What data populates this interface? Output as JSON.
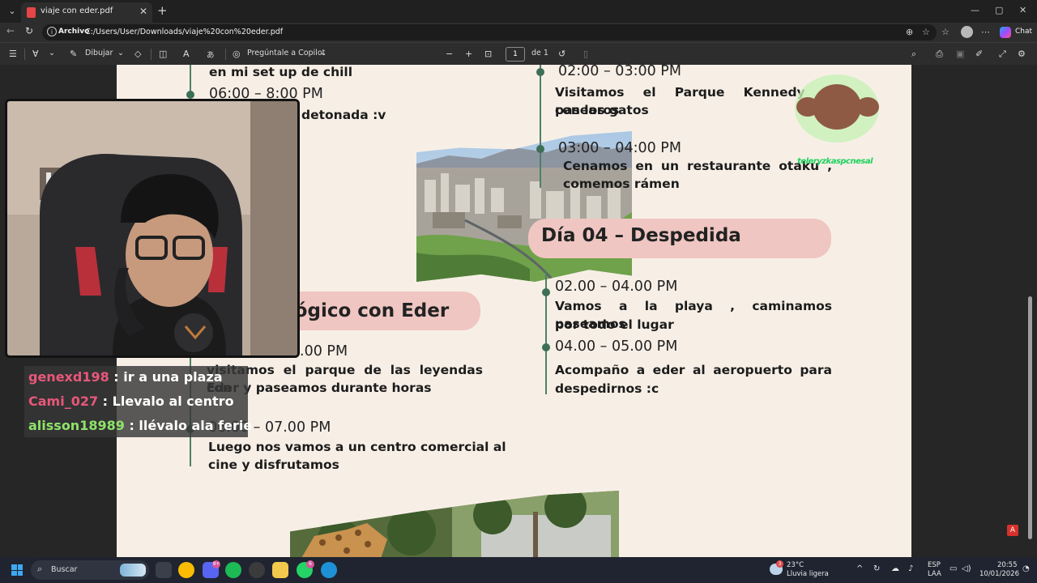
{
  "browser": {
    "tab_title": "viaje con eder.pdf",
    "new_tab_symbol": "+",
    "close_symbol": "✕",
    "window_controls": [
      "—",
      "▢",
      "✕"
    ],
    "site_chip": "Archivo",
    "url": "C:/Users/User/Downloads/viaje%20con%20eder.pdf",
    "chat_label": "Chat"
  },
  "pdf_toolbar": {
    "draw_label": "Dibujar",
    "copilot_label": "Pregúntale a Copilot",
    "page_current": "1",
    "page_total_label": "de 1",
    "zoom_out": "−",
    "zoom_in": "+"
  },
  "document": {
    "left_column": {
      "top_text": "en mi set up de chill",
      "time_1": "06:00 – 8:00 PM",
      "text_1": "detonada :v",
      "day_heading_partial": "ológico con Eder",
      "time_2_partial": ".00 PM",
      "text_2_line1": "visitamos el parque de las leyendas con",
      "text_2_line2": "Eder y paseamos durante horas",
      "time_3": "06.00 – 07.00 PM",
      "text_3_line1": "Luego nos vamos a un centro comercial al",
      "text_3_line2": "cine y disfrutamos"
    },
    "right_column": {
      "time_1": "02:00 – 03:00 PM",
      "text_1_line1": "Visitamos el Parque Kennedy y pasearos",
      "text_1_line2": "con los gatos",
      "time_2": "03:00 – 04:00 PM",
      "text_2_line1": "Cenamos en un restaurante otaku ,",
      "text_2_line2": "comemos rámen",
      "day4_heading": "Día 04 – Despedida",
      "time_3": "02.00 – 04.00 PM",
      "text_3_line1": "Vamos a la playa , caminamos paseamos",
      "text_3_line2": "por todo el lugar",
      "time_4": "04.00 – 05.00 PM",
      "text_4_line1": "Acompaño a eder al aeropuerto para",
      "text_4_line2": "despedirnos :c"
    },
    "accent_colors": {
      "page_bg": "#f7efe6",
      "pill_pink": "#efc6c2",
      "timeline_green": "#3d6f57"
    }
  },
  "stream_overlay": {
    "chat": [
      {
        "user": "genexd198",
        "message": ": ir a una plaza",
        "color": "#e8577a"
      },
      {
        "user": "Cami_027",
        "message": ": Llevalo al centro",
        "color": "#e8577a"
      },
      {
        "user": "alisson18989",
        "message": ": llévalo ala ferie",
        "color": "#8fe36a"
      }
    ],
    "sticker_caption": "teleryzkaspcnesal"
  },
  "taskbar": {
    "search_label": "Buscar",
    "weather_temp": "23°C",
    "weather_desc": "Lluvia ligera",
    "weather_badge": "3",
    "discord_badge": "9+",
    "whatsapp_badge": "6",
    "lang_line1": "ESP",
    "lang_line2": "LAA",
    "time": "20:55",
    "date": "10/01/2026"
  },
  "icons": [
    "search-icon",
    "star-icon",
    "menu-icon",
    "refresh-icon",
    "back-icon",
    "forward-icon",
    "zoom-icon",
    "print-icon",
    "save-icon",
    "settings-icon",
    "eraser-icon",
    "rotate-icon",
    "pdf-icon",
    "windows-logo-icon"
  ]
}
